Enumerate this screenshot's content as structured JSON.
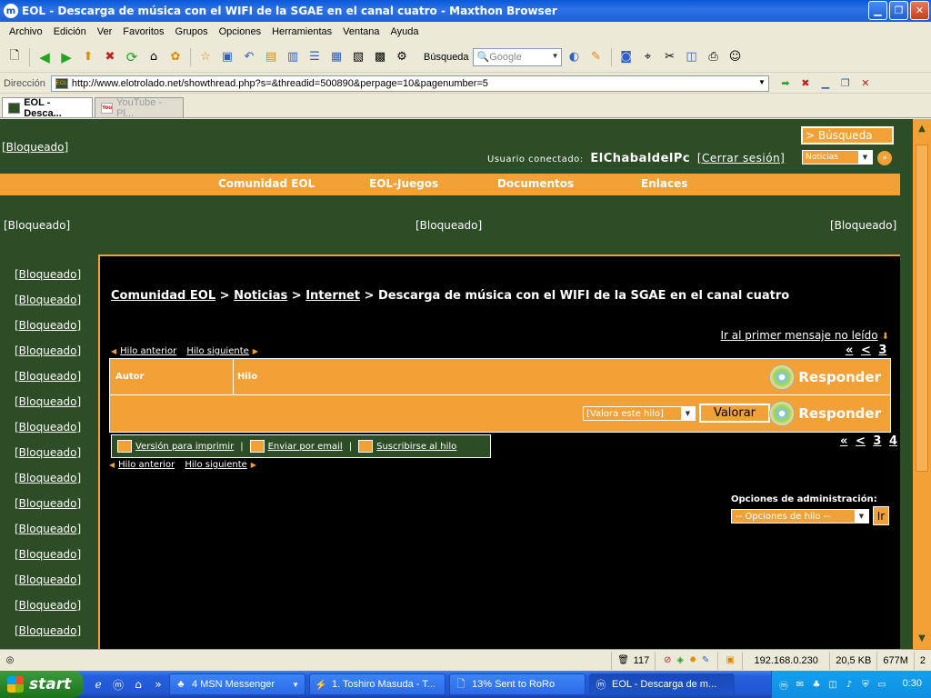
{
  "window": {
    "title": "EOL - Descarga de música con el WIFI de la SGAE en el canal cuatro - Maxthon Browser",
    "app_icon": "m"
  },
  "menu": [
    "Archivo",
    "Edición",
    "Ver",
    "Favoritos",
    "Grupos",
    "Opciones",
    "Herramientas",
    "Ventana",
    "Ayuda"
  ],
  "toolbar": {
    "search_label": "Búsqueda",
    "search_placeholder": "Google"
  },
  "address": {
    "label": "Dirección",
    "url": "http://www.elotrolado.net/showthread.php?s=&threadid=500890&perpage=10&pagenumber=5"
  },
  "tabs": [
    {
      "label": "EOL - Desca...",
      "active": true
    },
    {
      "label": "YouTube - Pl...",
      "active": false
    }
  ],
  "page": {
    "blocked": "[Bloqueado]",
    "user_prefix": "Usuario conectado:",
    "username": "ElChabaldelPc",
    "logout": "[Cerrar sesión]",
    "search_btn": "> Búsqueda",
    "search_scope": "Noticias",
    "nav": [
      "Comunidad EOL",
      "EOL-Juegos",
      "Documentos",
      "Enlaces"
    ],
    "breadcrumb": {
      "items": [
        "Comunidad EOL",
        "Noticias",
        "Internet"
      ],
      "current": "Descarga de música con el WIFI de la SGAE en el canal cuatro",
      "sep": ">"
    },
    "first_unread": "Ir al primer mensaje no leído",
    "prev_thread": "Hilo anterior",
    "next_thread": "Hilo siguiente",
    "pager": {
      "first": "«",
      "prev": "<",
      "p3": "3",
      "p4": "4"
    },
    "table": {
      "col_author": "Autor",
      "col_thread": "Hilo",
      "reply": "Responder",
      "rate_select": "[Valora este hilo]",
      "rate_btn": "Valorar"
    },
    "tools": {
      "print": "Versión para imprimir",
      "email": "Enviar por email",
      "subscribe": "Suscribirse al hilo",
      "sep": "|"
    },
    "admin": {
      "label": "Opciones de administración:",
      "select": "-- Opciones de hilo --",
      "go": "Ir"
    }
  },
  "status": {
    "count": "117",
    "ip": "192.168.0.230",
    "size": "20,5 KB",
    "mem": "677M",
    "num": "2"
  },
  "taskbar": {
    "start": "start",
    "tasks": [
      {
        "label": "4 MSN Messenger",
        "icon": "msn-icon"
      },
      {
        "label": "1. Toshiro Masuda - T...",
        "icon": "winamp-icon"
      },
      {
        "label": "13% Sent to RoRo",
        "icon": "file-icon"
      },
      {
        "label": "EOL - Descarga de m...",
        "icon": "maxthon-icon"
      }
    ],
    "clock": "0:30"
  }
}
